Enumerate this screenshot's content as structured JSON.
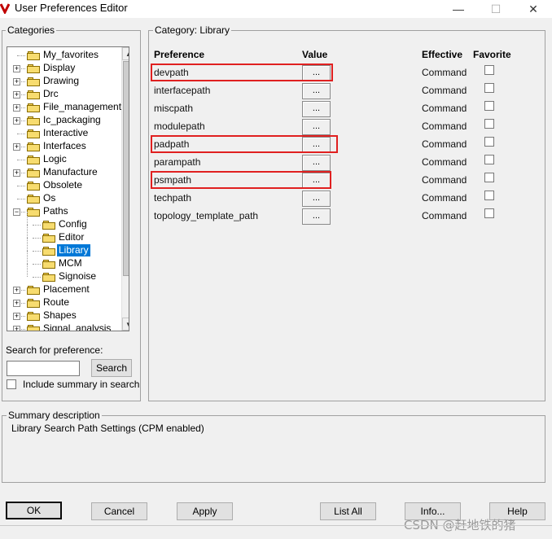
{
  "window": {
    "title": "User Preferences Editor",
    "controls": {
      "minimize": "—",
      "maximize": "☐",
      "close": "✕"
    }
  },
  "categories": {
    "label": "Categories",
    "tree": [
      {
        "label": "My_favorites",
        "expandable": false,
        "level": 0
      },
      {
        "label": "Display",
        "expandable": true,
        "level": 0
      },
      {
        "label": "Drawing",
        "expandable": true,
        "level": 0
      },
      {
        "label": "Drc",
        "expandable": true,
        "level": 0
      },
      {
        "label": "File_management",
        "expandable": true,
        "level": 0
      },
      {
        "label": "Ic_packaging",
        "expandable": true,
        "level": 0
      },
      {
        "label": "Interactive",
        "expandable": false,
        "level": 0
      },
      {
        "label": "Interfaces",
        "expandable": true,
        "level": 0
      },
      {
        "label": "Logic",
        "expandable": false,
        "level": 0
      },
      {
        "label": "Manufacture",
        "expandable": true,
        "level": 0
      },
      {
        "label": "Obsolete",
        "expandable": false,
        "level": 0
      },
      {
        "label": "Os",
        "expandable": false,
        "level": 0
      },
      {
        "label": "Paths",
        "expandable": true,
        "expanded": true,
        "level": 0
      },
      {
        "label": "Config",
        "expandable": false,
        "level": 1
      },
      {
        "label": "Editor",
        "expandable": false,
        "level": 1
      },
      {
        "label": "Library",
        "expandable": false,
        "level": 1,
        "selected": true
      },
      {
        "label": "MCM",
        "expandable": false,
        "level": 1
      },
      {
        "label": "Signoise",
        "expandable": false,
        "level": 1
      },
      {
        "label": "Placement",
        "expandable": true,
        "level": 0
      },
      {
        "label": "Route",
        "expandable": true,
        "level": 0
      },
      {
        "label": "Shapes",
        "expandable": true,
        "level": 0
      },
      {
        "label": "Signal_analysis",
        "expandable": true,
        "level": 0
      }
    ],
    "search_label": "Search for preference:",
    "search_value": "",
    "search_button": "Search",
    "include_summary": "Include summary in search"
  },
  "category_panel": {
    "label": "Category:  Library",
    "headers": {
      "preference": "Preference",
      "value": "Value",
      "effective": "Effective",
      "favorite": "Favorite"
    },
    "ellipsis": "...",
    "rows": [
      {
        "name": "devpath",
        "effective": "Command",
        "highlighted": true
      },
      {
        "name": "interfacepath",
        "effective": "Command",
        "highlighted": false
      },
      {
        "name": "miscpath",
        "effective": "Command",
        "highlighted": false
      },
      {
        "name": "modulepath",
        "effective": "Command",
        "highlighted": false
      },
      {
        "name": "padpath",
        "effective": "Command",
        "highlighted": true
      },
      {
        "name": "parampath",
        "effective": "Command",
        "highlighted": false
      },
      {
        "name": "psmpath",
        "effective": "Command",
        "highlighted": true
      },
      {
        "name": "techpath",
        "effective": "Command",
        "highlighted": false
      },
      {
        "name": "topology_template_path",
        "effective": "Command",
        "highlighted": false
      }
    ]
  },
  "summary": {
    "label": "Summary description",
    "text": "Library Search Path Settings (CPM enabled)"
  },
  "buttons": {
    "ok": "OK",
    "cancel": "Cancel",
    "apply": "Apply",
    "list_all": "List All",
    "info": "Info...",
    "help": "Help"
  },
  "watermark": "CSDN @赶地铁的猪",
  "colors": {
    "selection": "#0078d7",
    "highlight_box": "#e02020"
  }
}
